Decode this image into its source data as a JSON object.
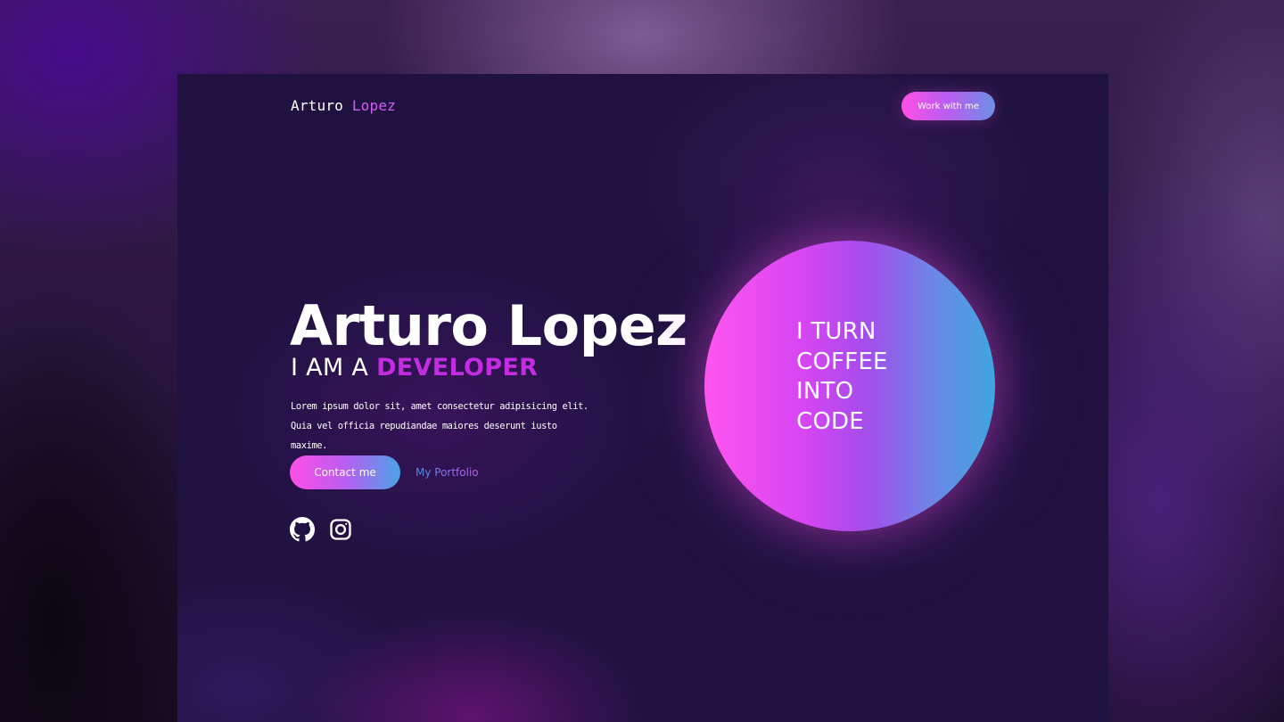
{
  "nav": {
    "logo_first": "Arturo",
    "logo_last": "Lopez",
    "cta_label": "Work with me"
  },
  "hero": {
    "name": "Arturo Lopez",
    "role_prefix": "I AM A",
    "role_accent": "DEVELOPER",
    "description": "Lorem ipsum dolor sit, amet consectetur adipisicing elit. Quia vel officia repudiandae maiores deserunt iusto maxime.",
    "primary_button": "Contact me",
    "secondary_link": "My Portfolio",
    "social_icons": [
      "github-icon",
      "instagram-icon"
    ]
  },
  "orb": {
    "lines": [
      "I TURN",
      "COFFEE",
      "INTO",
      "CODE"
    ]
  },
  "colors": {
    "accent_pink": "#ff4fe6",
    "accent_purple": "#c32ce0",
    "accent_blue": "#4aa3e8",
    "background": "#1f1240"
  }
}
